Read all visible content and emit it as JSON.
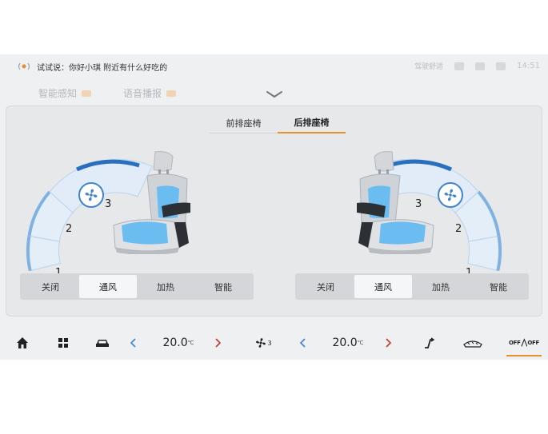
{
  "status_bar": {
    "voice_hint": "试试说：你好小琪 附近有什么好吃的",
    "right_text": "驾驶舒适",
    "time": "14:51"
  },
  "background_tabs": [
    "智能感知",
    "语音播报"
  ],
  "seat_tabs": [
    {
      "label": "前排座椅",
      "active": false
    },
    {
      "label": "后排座椅",
      "active": true
    }
  ],
  "left_seat": {
    "dial_levels": [
      "1",
      "2",
      "3"
    ],
    "active_level": 3,
    "modes": [
      {
        "label": "关闭",
        "active": false
      },
      {
        "label": "通风",
        "active": true
      },
      {
        "label": "加热",
        "active": false
      },
      {
        "label": "智能",
        "active": false
      }
    ]
  },
  "right_seat": {
    "dial_levels": [
      "1",
      "2",
      "3"
    ],
    "active_level": 3,
    "modes": [
      {
        "label": "关闭",
        "active": false
      },
      {
        "label": "通风",
        "active": true
      },
      {
        "label": "加热",
        "active": false
      },
      {
        "label": "智能",
        "active": false
      }
    ]
  },
  "bottom_bar": {
    "left_temp": "20.0",
    "right_temp": "20.0",
    "temp_unit": "℃",
    "fan_level": "3",
    "off_label": "OFF"
  },
  "colors": {
    "accent_blue": "#3f84cc",
    "accent_orange": "#e88e2c",
    "seat_blue": "#6bbcf0"
  }
}
